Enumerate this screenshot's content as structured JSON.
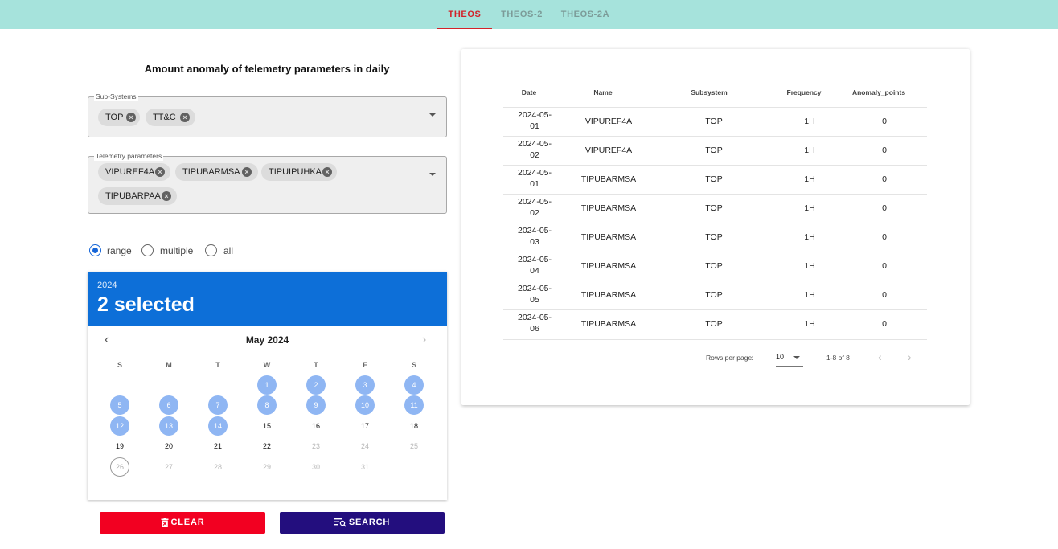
{
  "tabs": [
    {
      "label": "THEOS",
      "active": true
    },
    {
      "label": "THEOS-2",
      "active": false
    },
    {
      "label": "THEOS-2A",
      "active": false
    }
  ],
  "page_title": "Amount anomaly of telemetry parameters in daily",
  "subsystems": {
    "legend": "Sub-Systems",
    "chips": [
      "TOP",
      "TT&C"
    ]
  },
  "telemetry": {
    "legend": "Telemetry parameters",
    "chips": [
      "VIPUREF4A",
      "TIPUBARMSA",
      "TIPUIPUHKA",
      "TIPUBARPAA"
    ]
  },
  "mode": {
    "options": [
      "range",
      "multiple",
      "all"
    ],
    "selected": "range"
  },
  "calendar": {
    "year": "2024",
    "selected_text": "2 selected",
    "month_label": "May 2024",
    "weekdays": [
      "S",
      "M",
      "T",
      "W",
      "T",
      "F",
      "S"
    ],
    "first_weekday_index": 3,
    "days_in_month": 31,
    "selected_days": [
      1,
      2,
      3,
      4,
      5,
      6,
      7,
      8,
      9,
      10,
      11,
      12,
      13,
      14
    ],
    "today": 26,
    "disabled_after": 22
  },
  "buttons": {
    "clear": "CLEAR",
    "search": "SEARCH"
  },
  "table": {
    "columns": [
      "Date",
      "Name",
      "Subsystem",
      "Frequency",
      "Anomaly_points"
    ],
    "rows": [
      {
        "date_a": "2024-05-",
        "date_b": "01",
        "name": "VIPUREF4A",
        "subsystem": "TOP",
        "frequency": "1H",
        "anomaly": "0"
      },
      {
        "date_a": "2024-05-",
        "date_b": "02",
        "name": "VIPUREF4A",
        "subsystem": "TOP",
        "frequency": "1H",
        "anomaly": "0"
      },
      {
        "date_a": "2024-05-",
        "date_b": "01",
        "name": "TIPUBARMSA",
        "subsystem": "TOP",
        "frequency": "1H",
        "anomaly": "0"
      },
      {
        "date_a": "2024-05-",
        "date_b": "02",
        "name": "TIPUBARMSA",
        "subsystem": "TOP",
        "frequency": "1H",
        "anomaly": "0"
      },
      {
        "date_a": "2024-05-",
        "date_b": "03",
        "name": "TIPUBARMSA",
        "subsystem": "TOP",
        "frequency": "1H",
        "anomaly": "0"
      },
      {
        "date_a": "2024-05-",
        "date_b": "04",
        "name": "TIPUBARMSA",
        "subsystem": "TOP",
        "frequency": "1H",
        "anomaly": "0"
      },
      {
        "date_a": "2024-05-",
        "date_b": "05",
        "name": "TIPUBARMSA",
        "subsystem": "TOP",
        "frequency": "1H",
        "anomaly": "0"
      },
      {
        "date_a": "2024-05-",
        "date_b": "06",
        "name": "TIPUBARMSA",
        "subsystem": "TOP",
        "frequency": "1H",
        "anomaly": "0"
      }
    ],
    "rows_per_page_label": "Rows per page:",
    "rows_per_page": "10",
    "range_text": "1-8 of 8"
  },
  "colors": {
    "topbar": "#a6e3dc",
    "active_tab": "#d2232a",
    "calendar_header": "#0d6fd8",
    "selected_day": "#8fb6f3",
    "clear_button": "#f20021",
    "search_button": "#230e7e"
  },
  "icons": {
    "chip_delete": "cancel-circle-icon",
    "dropdown": "arrow-drop-down-icon",
    "prev_month": "chevron-left-icon",
    "next_month": "chevron-right-icon",
    "clear": "trash-icon",
    "search": "search-list-icon",
    "prev_page": "chevron-left-icon",
    "next_page": "chevron-right-icon"
  }
}
